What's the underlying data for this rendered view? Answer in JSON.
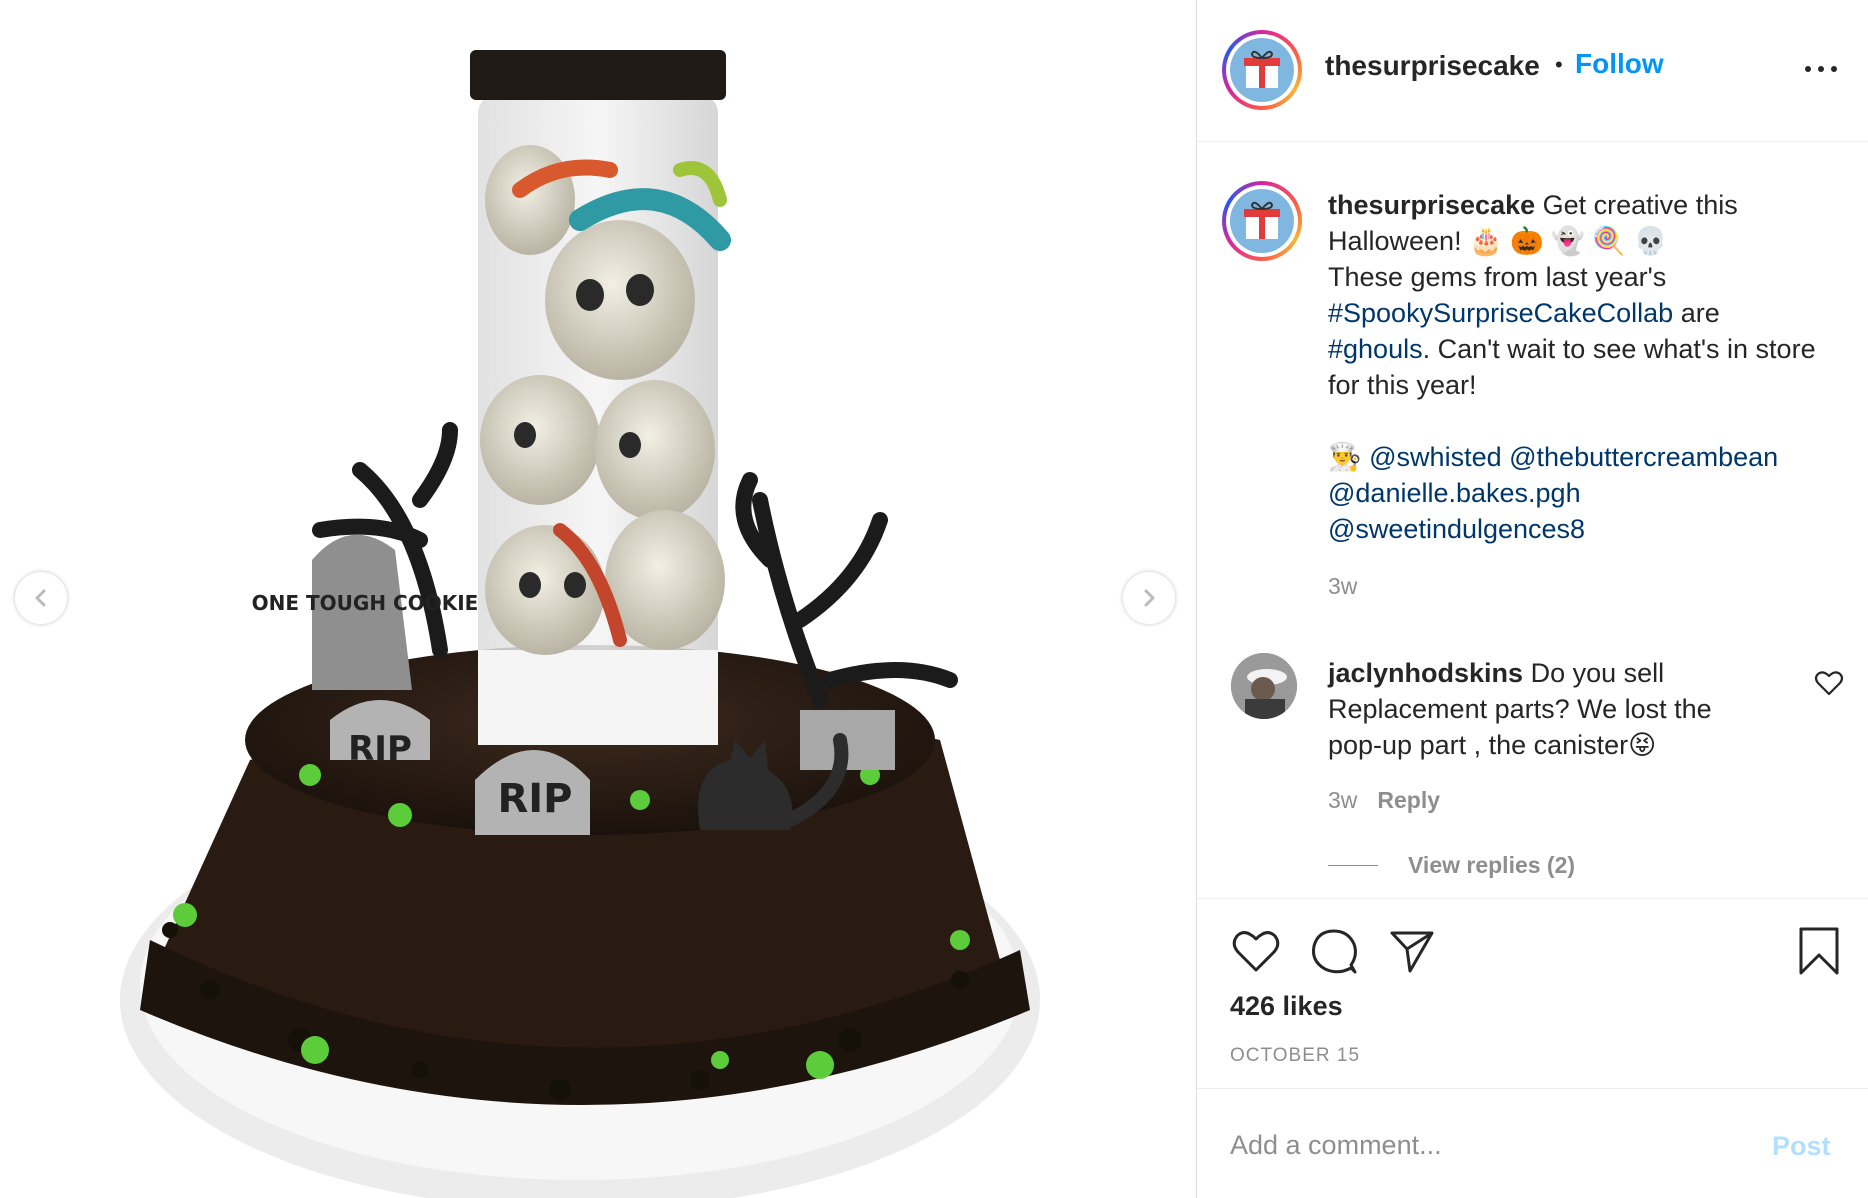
{
  "post": {
    "username": "thesurprisecake",
    "dot": "•",
    "follow_label": "Follow",
    "more_icon": "more-options-icon"
  },
  "caption": {
    "username": "thesurprisecake",
    "line1": " Get creative this Halloween! 🎂 🎃 👻 🍭 💀",
    "line2": "These gems from last year's",
    "hashtag1": "#SpookySurpriseCakeCollab",
    "line3": " are",
    "hashtag2": "#ghouls",
    "line4": ". Can't wait to see what's in store for this year!",
    "chef_emoji": "👨‍🍳",
    "mention1": "@swhisted",
    "mention2": "@thebuttercreambean",
    "mention3": "@danielle.bakes.pgh",
    "mention4": "@sweetindulgences8",
    "time": "3w"
  },
  "comment": {
    "username": "jaclynhodskins",
    "text": " Do you sell Replacement parts? We lost the pop-up part , the canister😝",
    "time": "3w",
    "reply_label": "Reply",
    "view_replies": "View replies (2)"
  },
  "stats": {
    "likes": "426 likes",
    "date": "OCTOBER 15"
  },
  "add_comment": {
    "placeholder": "Add a comment...",
    "post_label": "Post"
  },
  "image": {
    "tombstone1": "ONE TOUGH COOKIE",
    "rip1": "RIP",
    "rip2": "RIP"
  },
  "colors": {
    "link": "#00376b",
    "follow": "#0095f6",
    "post_disabled": "#b2dffc",
    "muted": "#8e8e8e"
  }
}
